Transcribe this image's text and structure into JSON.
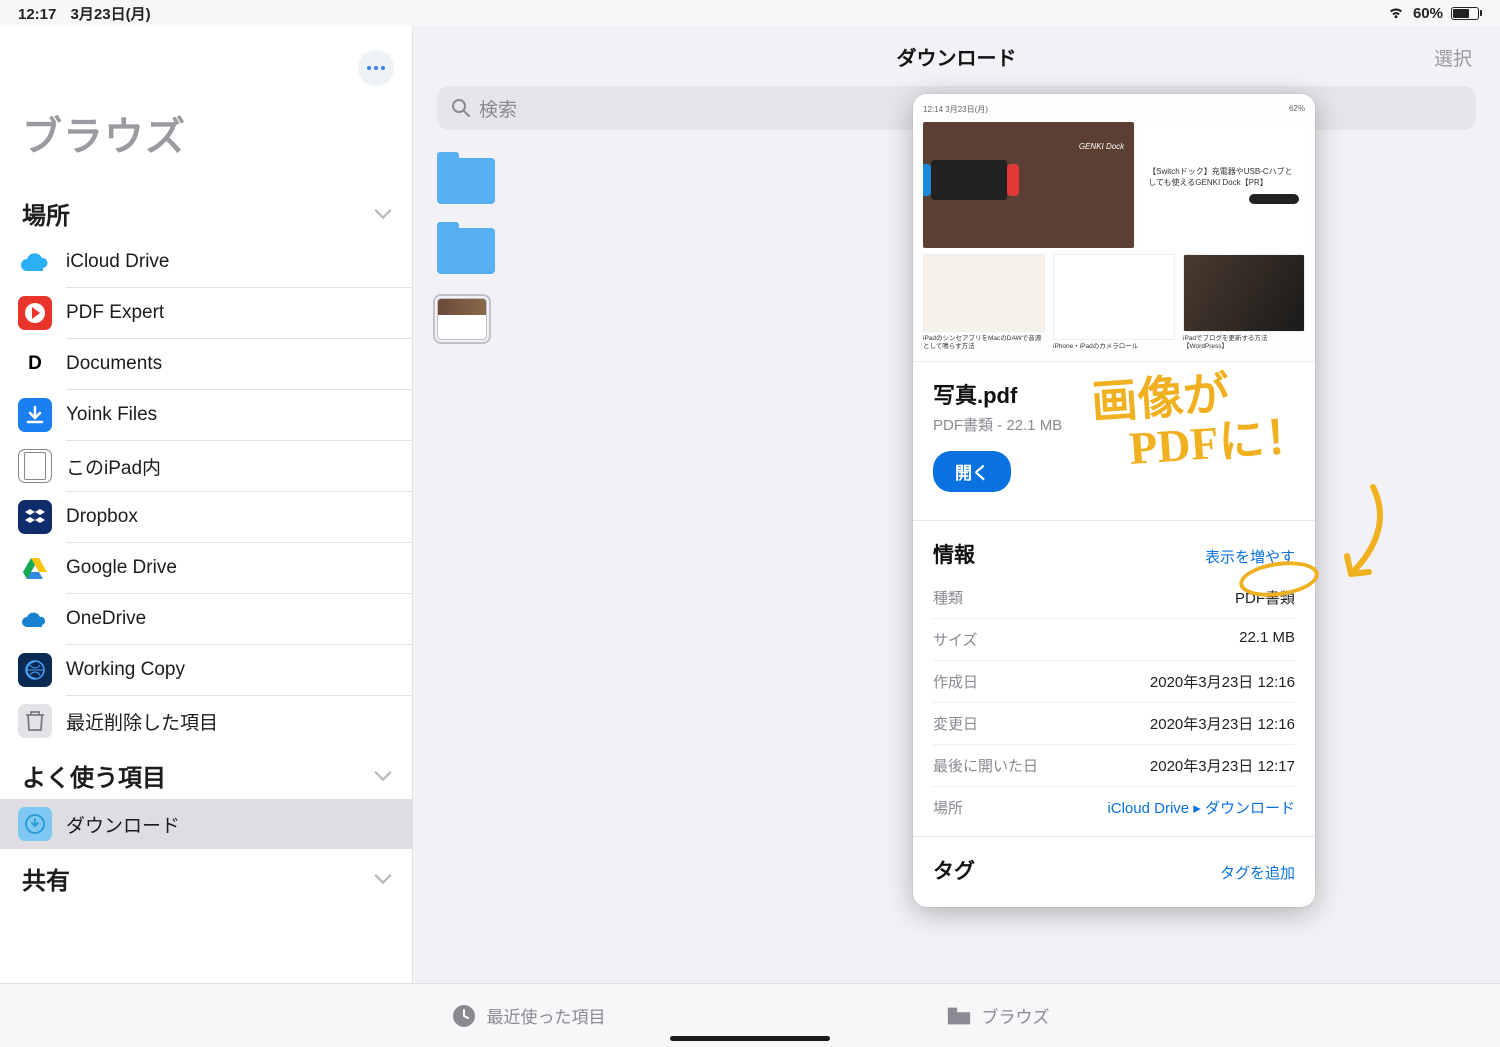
{
  "status": {
    "time": "12:17",
    "date": "3月23日(月)",
    "battery_pct": "60%"
  },
  "sidebar": {
    "more_label": "more",
    "title": "ブラウズ",
    "sections": {
      "locations": {
        "header": "場所",
        "items": [
          {
            "label": "iCloud Drive",
            "icon": "icloud"
          },
          {
            "label": "PDF Expert",
            "icon": "pdfexp"
          },
          {
            "label": "Documents",
            "icon": "docs"
          },
          {
            "label": "Yoink Files",
            "icon": "yoink"
          },
          {
            "label": "このiPad内",
            "icon": "ipad"
          },
          {
            "label": "Dropbox",
            "icon": "dropbox"
          },
          {
            "label": "Google Drive",
            "icon": "gdrive"
          },
          {
            "label": "OneDrive",
            "icon": "onedrive"
          },
          {
            "label": "Working Copy",
            "icon": "wcopy"
          },
          {
            "label": "最近削除した項目",
            "icon": "trash"
          }
        ]
      },
      "favorites": {
        "header": "よく使う項目",
        "items": [
          {
            "label": "ダウンロード",
            "icon": "dl",
            "selected": true
          }
        ]
      },
      "shared": {
        "header": "共有"
      }
    }
  },
  "content": {
    "title": "ダウンロード",
    "select": "選択",
    "search_placeholder": "検索"
  },
  "popover": {
    "filename": "写真.pdf",
    "subtitle": "PDF書類 - 22.1 MB",
    "open": "開く",
    "info_header": "情報",
    "show_more": "表示を増やす",
    "rows": {
      "kind_k": "種類",
      "kind_v": "PDF書類",
      "size_k": "サイズ",
      "size_v": "22.1 MB",
      "created_k": "作成日",
      "created_v": "2020年3月23日 12:16",
      "modified_k": "変更日",
      "modified_v": "2020年3月23日 12:16",
      "opened_k": "最後に開いた日",
      "opened_v": "2020年3月23日 12:17",
      "where_k": "場所",
      "where_v": "iCloud Drive ▸ ダウンロード"
    },
    "tags_header": "タグ",
    "tags_add": "タグを追加",
    "preview": {
      "hero_tag": "GENKI Dock",
      "side_text": "【Switchドック】充電器やUSB-Cハブとしても使えるGENKI Dock【PR】",
      "cap1": "iPadのシンセアプリをMacのDAWで音源として鳴らす方法",
      "cap2": "iPhone・iPadのカメラロール",
      "cap3": "iPadでブログを更新する方法【WordPress】"
    }
  },
  "annotation": {
    "line1": "画像が",
    "line2": "PDFに！"
  },
  "tabs": {
    "recent": "最近使った項目",
    "browse": "ブラウズ"
  }
}
